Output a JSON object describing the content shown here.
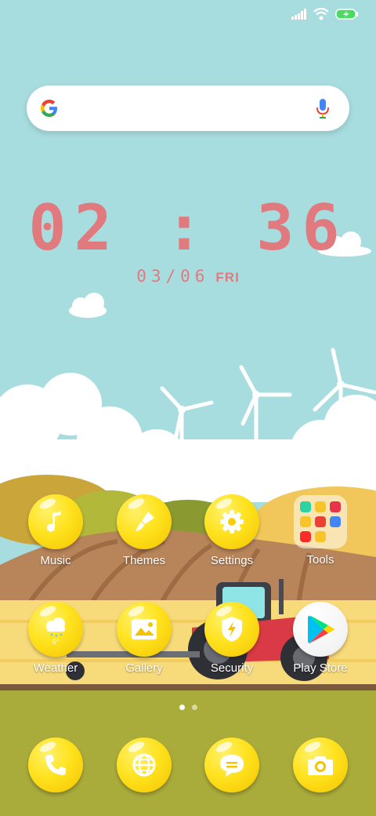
{
  "status_bar": {
    "signal_icon": "signal-icon",
    "wifi_icon": "wifi-icon",
    "battery_icon": "battery-charging-icon"
  },
  "search": {
    "logo": "google-g-icon",
    "mic": "mic-icon"
  },
  "clock": {
    "time": "02 : 36",
    "date": "03/06",
    "weekday": "FRI"
  },
  "apps_row1": [
    {
      "label": "Music",
      "icon": "music-note-icon"
    },
    {
      "label": "Themes",
      "icon": "paintbrush-icon"
    },
    {
      "label": "Settings",
      "icon": "gear-icon"
    },
    {
      "label": "Tools",
      "icon": "folder-icon"
    }
  ],
  "apps_row2": [
    {
      "label": "Weather",
      "icon": "weather-icon",
      "temperature": "6°"
    },
    {
      "label": "Gallery",
      "icon": "image-icon"
    },
    {
      "label": "Security",
      "icon": "shield-icon"
    },
    {
      "label": "Play Store",
      "icon": "play-store-icon"
    }
  ],
  "page_indicator": {
    "pages": 2,
    "current": 1
  },
  "dock": [
    {
      "name": "phone",
      "icon": "phone-icon"
    },
    {
      "name": "browser",
      "icon": "globe-icon"
    },
    {
      "name": "messages",
      "icon": "message-icon"
    },
    {
      "name": "camera",
      "icon": "camera-icon"
    }
  ],
  "colors": {
    "sky": "#a8dde0",
    "clock": "#e07a7f",
    "bubble": "#ffe21e",
    "ground": "#a9ab3a"
  }
}
